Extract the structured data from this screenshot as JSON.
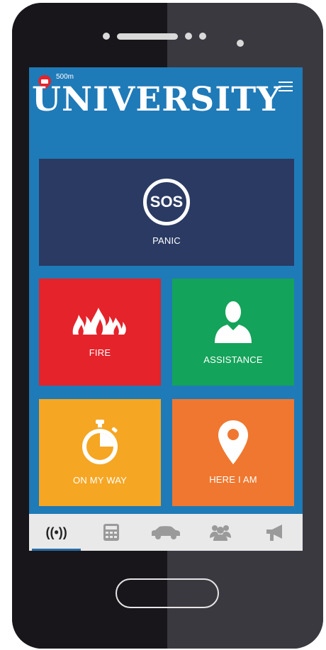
{
  "header": {
    "distance": "500m",
    "title": "UNIVERSITY"
  },
  "tiles": {
    "panic": {
      "icon_text": "SOS",
      "label": "PANIC"
    },
    "fire": {
      "label": "FIRE"
    },
    "assistance": {
      "label": "ASSISTANCE"
    },
    "on_my_way": {
      "label": "ON MY WAY"
    },
    "here_i_am": {
      "label": "HERE I AM"
    }
  },
  "tabbar": {
    "items": [
      {
        "icon": "broadcast-icon",
        "glyph": "((•))",
        "selected": true
      },
      {
        "icon": "calculator-icon",
        "selected": false
      },
      {
        "icon": "car-icon",
        "selected": false
      },
      {
        "icon": "group-icon",
        "selected": false
      },
      {
        "icon": "megaphone-icon",
        "selected": false
      }
    ]
  },
  "colors": {
    "screen_bg": "#1f7ab8",
    "panic": "#2a3a63",
    "fire": "#e4232b",
    "assistance": "#14a35a",
    "on_my_way": "#f5a623",
    "here_i_am": "#f0772f"
  }
}
